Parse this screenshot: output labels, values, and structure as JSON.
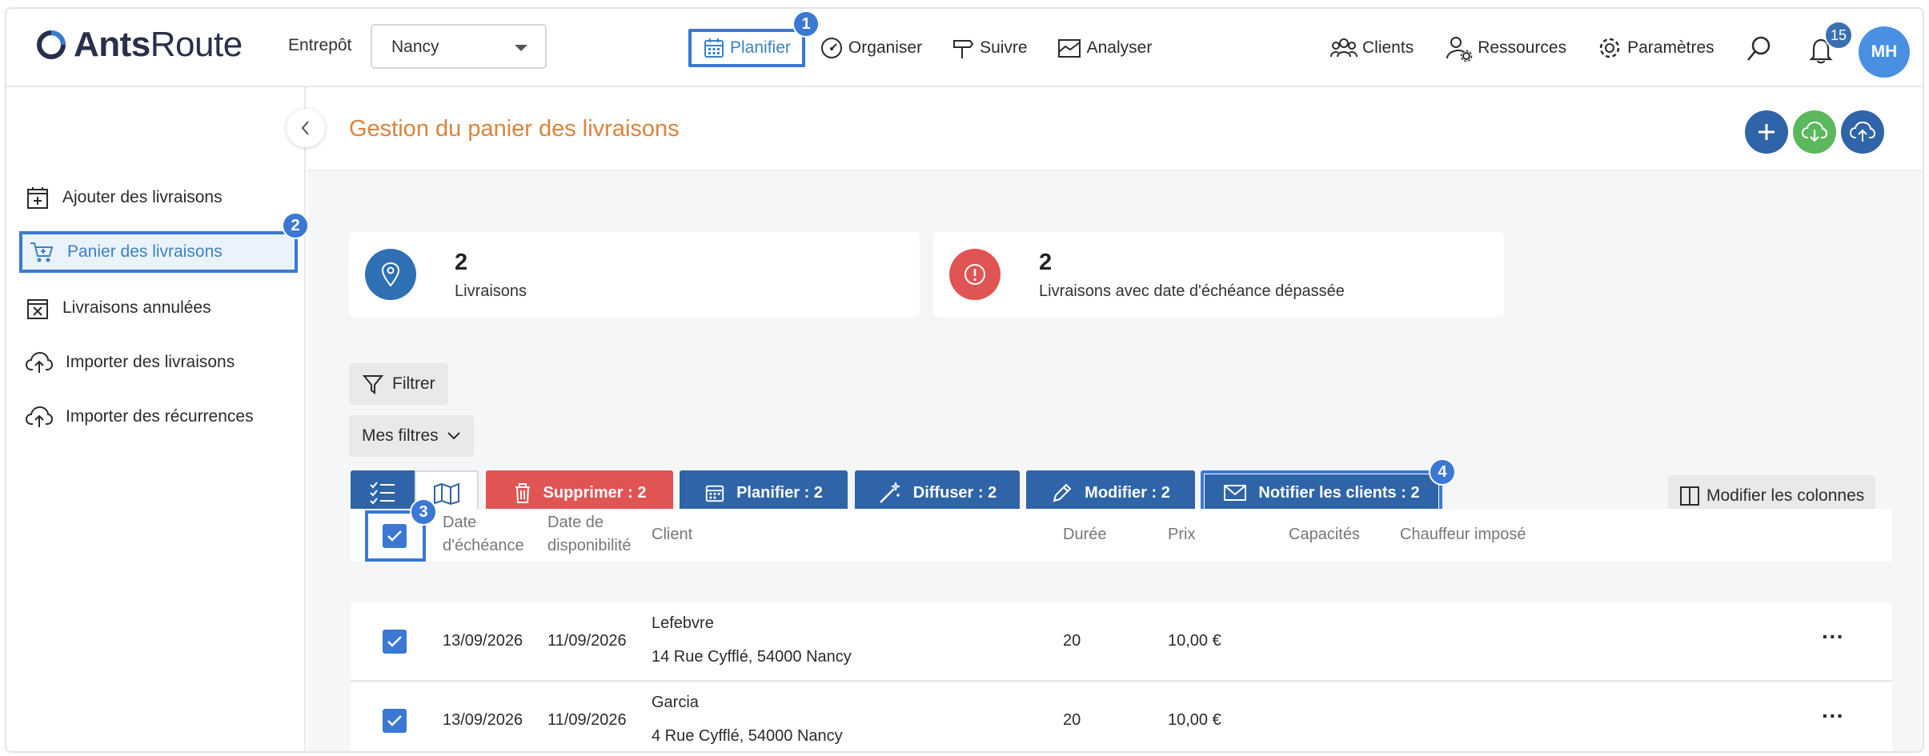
{
  "app": {
    "logo_bold": "Ants",
    "logo_light": "Route"
  },
  "header": {
    "entrepot_label": "Entrepôt",
    "entrepot_value": "Nancy",
    "nav": [
      {
        "label": "Planifier",
        "icon": "calendar-icon",
        "active": true
      },
      {
        "label": "Organiser",
        "icon": "gauge-icon"
      },
      {
        "label": "Suivre",
        "icon": "signpost-icon"
      },
      {
        "label": "Analyser",
        "icon": "chart-icon"
      }
    ],
    "right_nav": [
      {
        "label": "Clients",
        "icon": "users-icon"
      },
      {
        "label": "Ressources",
        "icon": "user-gear-icon"
      },
      {
        "label": "Paramètres",
        "icon": "gear-icon"
      }
    ],
    "notifications_count": "15",
    "avatar_initials": "MH"
  },
  "steps": {
    "s1": "1",
    "s2": "2",
    "s3": "3",
    "s4": "4"
  },
  "sidebar": {
    "items": [
      {
        "label": "Ajouter des livraisons",
        "icon": "calendar-plus-icon"
      },
      {
        "label": "Panier des livraisons",
        "icon": "cart-icon",
        "active": true
      },
      {
        "label": "Livraisons annulées",
        "icon": "calendar-x-icon"
      },
      {
        "label": "Importer des livraisons",
        "icon": "cloud-upload-icon"
      },
      {
        "label": "Importer des récurrences",
        "icon": "cloud-upload-icon"
      }
    ]
  },
  "main": {
    "title": "Gestion du panier des livraisons",
    "stats": [
      {
        "value": "2",
        "label": "Livraisons",
        "color": "#2f6fb3"
      },
      {
        "value": "2",
        "label": "Livraisons avec date d'échéance dépassée",
        "color": "#e05454"
      }
    ],
    "filter_label": "Filtrer",
    "my_filters_label": "Mes filtres",
    "actions": {
      "delete": "Supprimer : 2",
      "plan": "Planifier : 2",
      "broadcast": "Diffuser : 2",
      "edit": "Modifier : 2",
      "notify": "Notifier les clients : 2"
    },
    "edit_columns_label": "Modifier les colonnes",
    "columns": {
      "due_date_1": "Date",
      "due_date_2": "d'échéance",
      "avail_1": "Date de",
      "avail_2": "disponibilité",
      "client": "Client",
      "duration": "Durée",
      "price": "Prix",
      "capacities": "Capacités",
      "driver": "Chauffeur imposé"
    },
    "rows": [
      {
        "due": "13/09/2026",
        "avail": "11/09/2026",
        "client": "Lefebvre",
        "address": "14 Rue Cyfflé, 54000 Nancy",
        "duration": "20",
        "price": "10,00 €",
        "more": "···"
      },
      {
        "due": "13/09/2026",
        "avail": "11/09/2026",
        "client": "Garcia",
        "address": "4 Rue Cyfflé, 54000 Nancy",
        "duration": "20",
        "price": "10,00 €",
        "more": "···"
      }
    ]
  },
  "colors": {
    "accent": "#3a78d4",
    "title_orange": "#d9843f",
    "danger": "#e05454",
    "primary_dark": "#2f64a8"
  }
}
